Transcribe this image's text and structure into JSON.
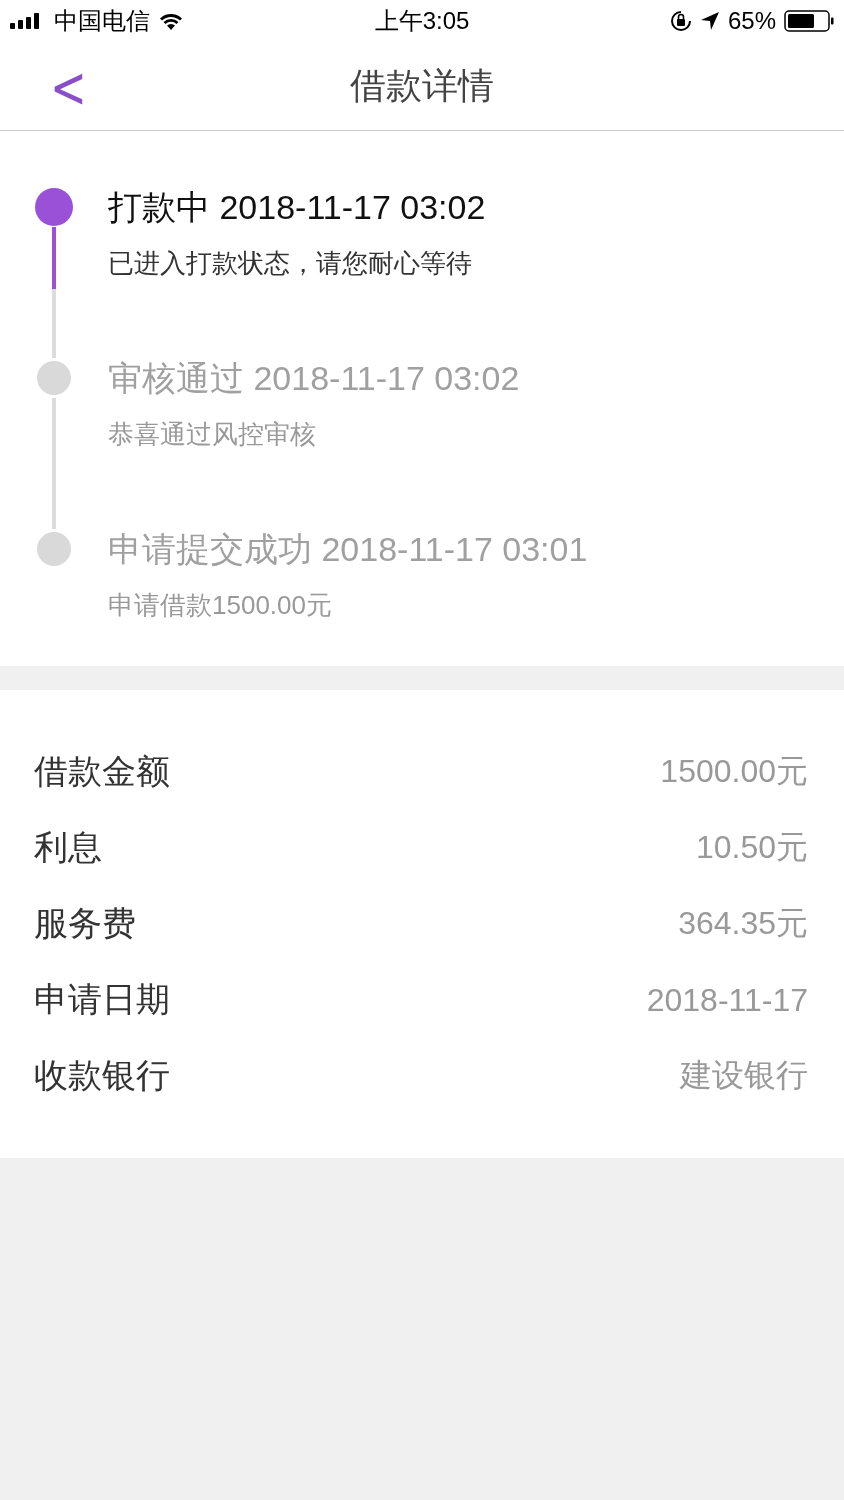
{
  "status_bar": {
    "carrier": "中国电信",
    "time": "上午3:05",
    "battery": "65%"
  },
  "nav": {
    "back": "<",
    "title": "借款详情"
  },
  "timeline": [
    {
      "title": "打款中 2018-11-17 03:02",
      "subtitle": "已进入打款状态，请您耐心等待",
      "active": true
    },
    {
      "title": "审核通过 2018-11-17 03:02",
      "subtitle": "恭喜通过风控审核",
      "active": false
    },
    {
      "title": "申请提交成功 2018-11-17 03:01",
      "subtitle": "申请借款1500.00元",
      "active": false
    }
  ],
  "details": [
    {
      "label": "借款金额",
      "value": "1500.00元"
    },
    {
      "label": "利息",
      "value": "10.50元"
    },
    {
      "label": "服务费",
      "value": "364.35元"
    },
    {
      "label": "申请日期",
      "value": "2018-11-17"
    },
    {
      "label": "收款银行",
      "value": "建设银行"
    }
  ]
}
